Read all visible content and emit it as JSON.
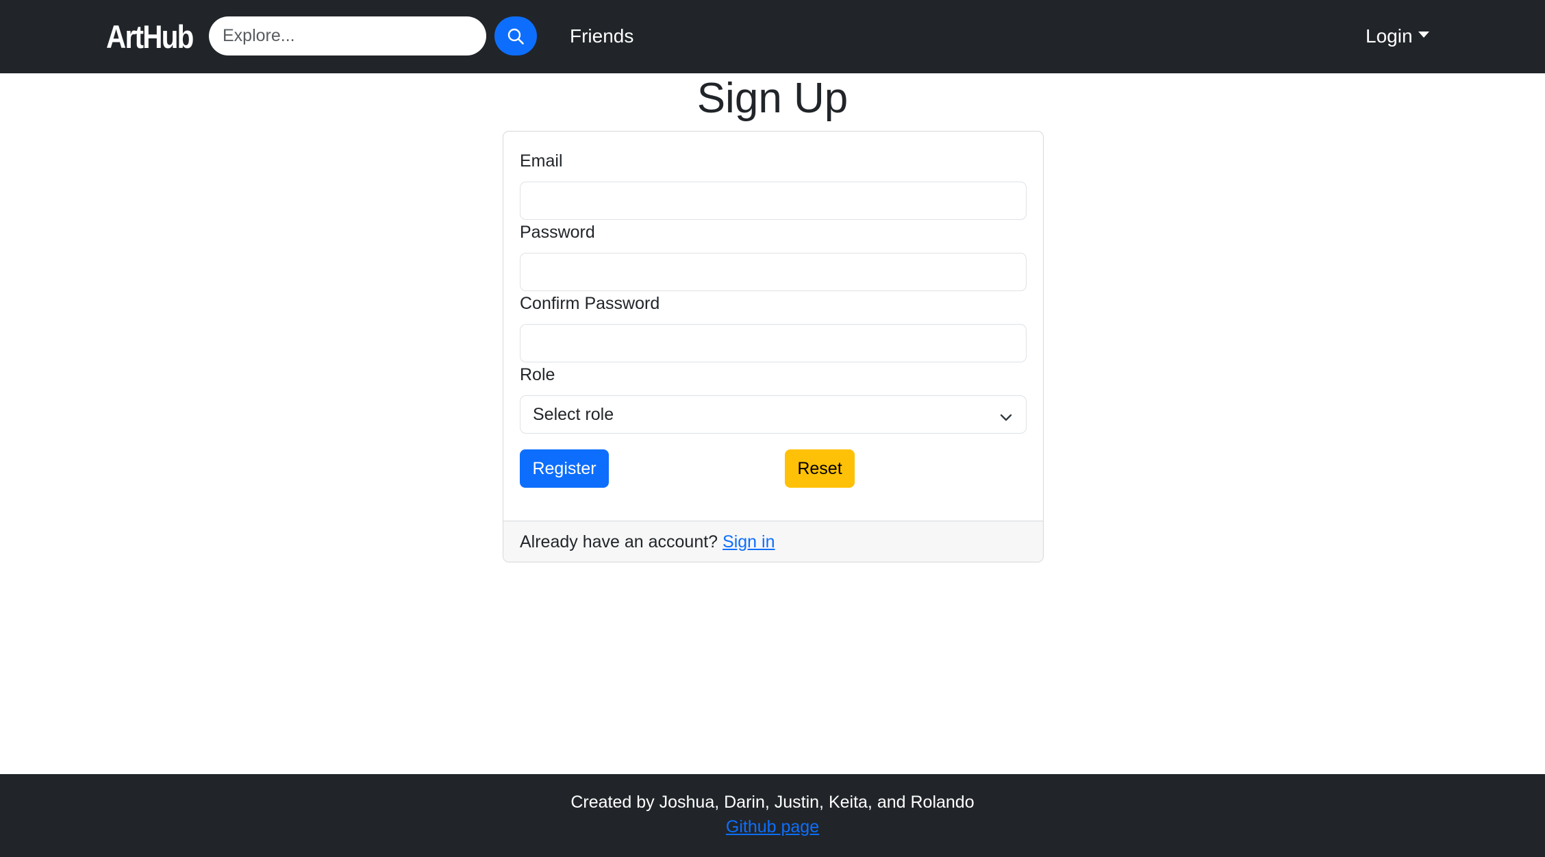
{
  "navbar": {
    "brand": "ArtHub",
    "search": {
      "placeholder": "Explore...",
      "value": ""
    },
    "search_icon": "search-icon",
    "links": [
      {
        "label": "Friends"
      }
    ],
    "login": {
      "label": "Login",
      "icon": "caret-down-icon"
    }
  },
  "page": {
    "title": "Sign Up"
  },
  "form": {
    "email": {
      "label": "Email",
      "value": ""
    },
    "password": {
      "label": "Password",
      "value": ""
    },
    "confirm_password": {
      "label": "Confirm Password",
      "value": ""
    },
    "role": {
      "label": "Role",
      "selected": "Select role",
      "icon": "chevron-down-icon"
    },
    "register_label": "Register",
    "reset_label": "Reset"
  },
  "card_footer": {
    "prompt": "Already have an account?",
    "link_label": "Sign in"
  },
  "footer": {
    "credit": "Created by Joshua, Darin, Justin, Keita, and Rolando",
    "link_label": "Github page"
  },
  "colors": {
    "navbar_bg": "#212529",
    "primary": "#0d6efd",
    "warning": "#ffc107",
    "card_footer_bg": "#f7f7f7"
  }
}
